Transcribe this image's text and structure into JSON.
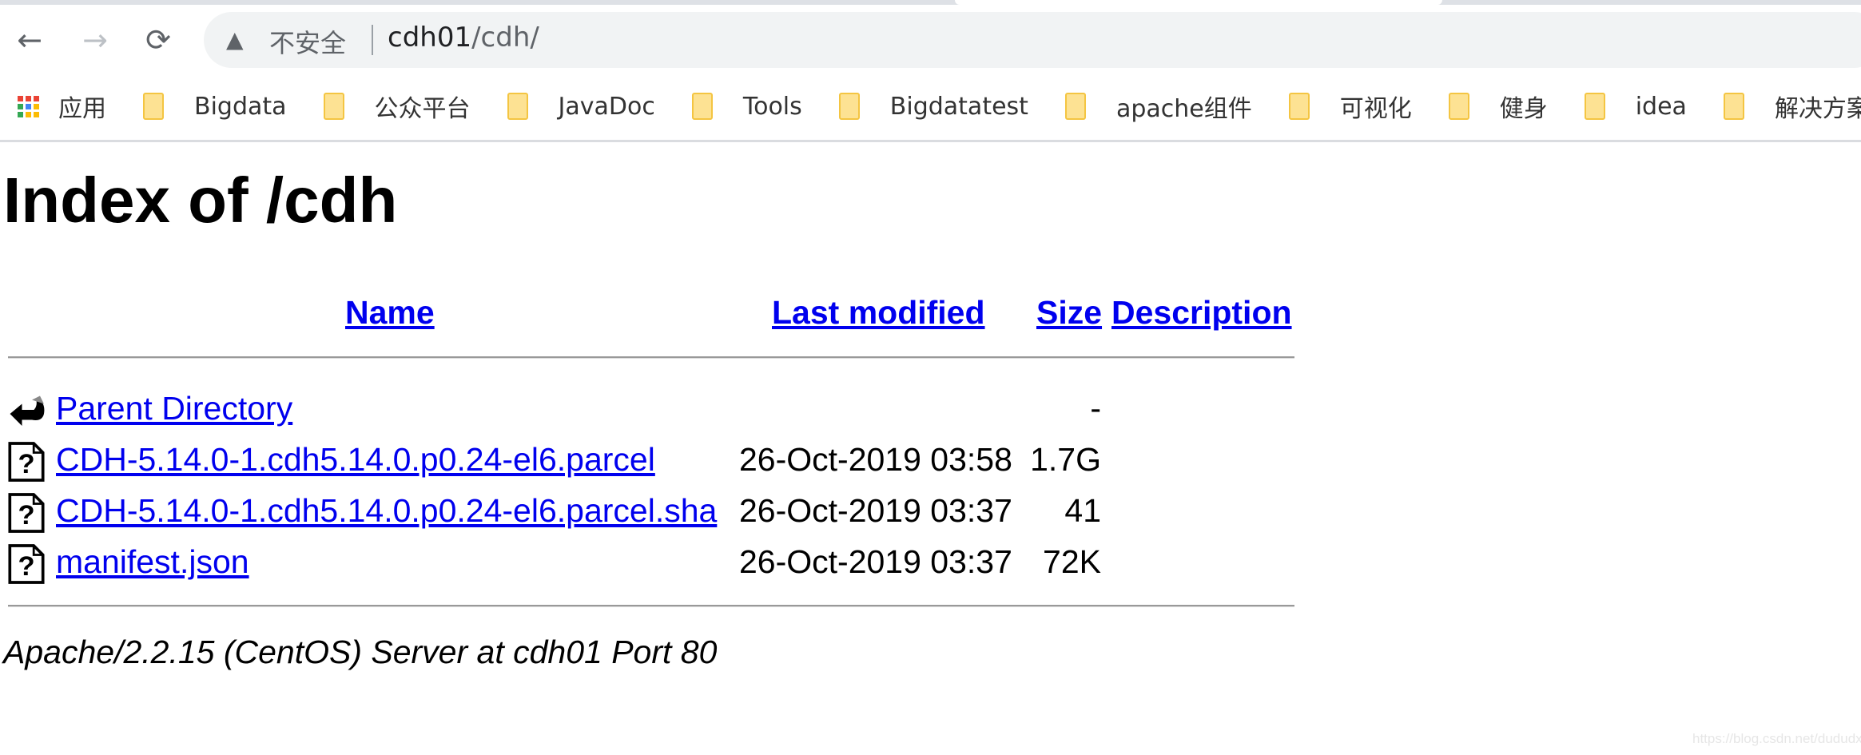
{
  "browser": {
    "nav": {
      "back": "←",
      "forward": "→",
      "reload": "⟳"
    },
    "security_label": "不安全",
    "url_host": "cdh01",
    "url_path": "/cdh/",
    "bookmarks": [
      {
        "label": "应用",
        "icon": "apps-grid-icon"
      },
      {
        "label": "Bigdata",
        "icon": "folder-icon"
      },
      {
        "label": "公众平台",
        "icon": "folder-icon"
      },
      {
        "label": "JavaDoc",
        "icon": "folder-icon"
      },
      {
        "label": "Tools",
        "icon": "folder-icon"
      },
      {
        "label": "Bigdatatest",
        "icon": "folder-icon"
      },
      {
        "label": "apache组件",
        "icon": "folder-icon"
      },
      {
        "label": "可视化",
        "icon": "folder-icon"
      },
      {
        "label": "健身",
        "icon": "folder-icon"
      },
      {
        "label": "idea",
        "icon": "folder-icon"
      },
      {
        "label": "解决方案",
        "icon": "folder-icon"
      },
      {
        "label": "",
        "icon": "folder-icon"
      }
    ]
  },
  "page": {
    "title": "Index of /cdh",
    "columns": {
      "name": "Name",
      "modified": "Last modified",
      "size": "Size",
      "description": "Description"
    },
    "rows": [
      {
        "icon": "back-arrow-icon",
        "name": "Parent Directory",
        "modified": "",
        "size": "-"
      },
      {
        "icon": "unknown-file-icon",
        "name": "CDH-5.14.0-1.cdh5.14.0.p0.24-el6.parcel",
        "modified": "26-Oct-2019 03:58",
        "size": "1.7G"
      },
      {
        "icon": "unknown-file-icon",
        "name": "CDH-5.14.0-1.cdh5.14.0.p0.24-el6.parcel.sha",
        "modified": "26-Oct-2019 03:37",
        "size": "41"
      },
      {
        "icon": "unknown-file-icon",
        "name": "manifest.json",
        "modified": "26-Oct-2019 03:37",
        "size": "72K"
      }
    ],
    "footer": "Apache/2.2.15 (CentOS) Server at cdh01 Port 80"
  },
  "watermark": "https://blog.csdn.net/dududxt",
  "colors": {
    "link": "#0000ee",
    "folder": "#fde293"
  }
}
